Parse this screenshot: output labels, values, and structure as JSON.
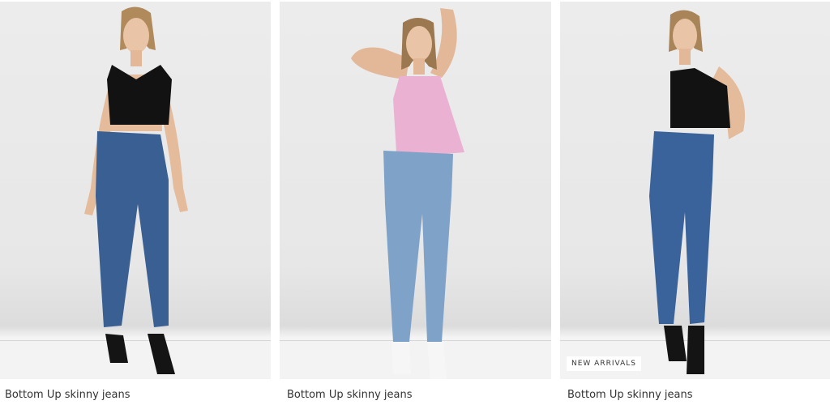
{
  "products": [
    {
      "title": "Bottom Up skinny jeans",
      "badge": "",
      "top_color": "#121212",
      "jeans_color": "#3a5f93"
    },
    {
      "title": "Bottom Up skinny jeans",
      "badge": "",
      "top_color": "#eab1d3",
      "jeans_color": "#7fa2c8"
    },
    {
      "title": "Bottom Up skinny jeans",
      "badge": "NEW ARRIVALS",
      "top_color": "#121212",
      "jeans_color": "#39639a"
    }
  ]
}
